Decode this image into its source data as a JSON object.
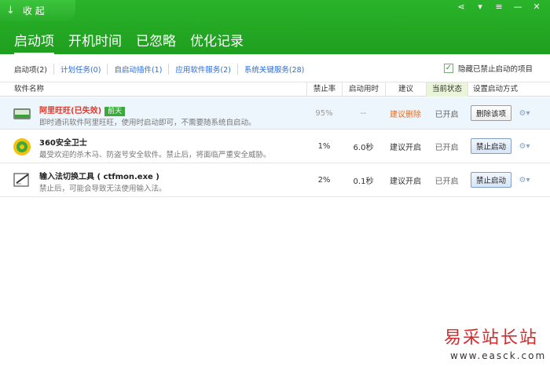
{
  "header": {
    "collapse_label": "收 起",
    "tabs": [
      {
        "label": "启动项"
      },
      {
        "label": "开机时间"
      },
      {
        "label": "已忽略"
      },
      {
        "label": "优化记录"
      }
    ]
  },
  "subnav": {
    "items": [
      {
        "label": "启动项(2)"
      },
      {
        "label": "计划任务(0)"
      },
      {
        "label": "自启动插件(1)"
      },
      {
        "label": "应用软件服务(2)"
      },
      {
        "label": "系统关键服务(28)"
      }
    ],
    "hide_disabled_label": "隐藏已禁止启动的项目",
    "hide_disabled_checked": true
  },
  "table": {
    "headers": {
      "name": "软件名称",
      "ban_rate": "禁止率",
      "boot_time": "启动用时",
      "suggestion": "建议",
      "state": "当前状态",
      "set": "设置启动方式"
    },
    "rows": [
      {
        "icon": "aliwangwang-icon",
        "name": "阿里旺旺(已失效)",
        "badge": "前天",
        "desc": "即时通讯软件阿里旺旺，使用时启动即可，不需要随系统自启动。",
        "ban_rate": "95%",
        "boot_time": "--",
        "suggestion": "建议删除",
        "state": "已开启",
        "button": "删除该项"
      },
      {
        "icon": "360-shield-icon",
        "name": "360安全卫士",
        "badge": "",
        "desc": "最受欢迎的杀木马、防盗号安全软件。禁止后，将面临严重安全威胁。",
        "ban_rate": "1%",
        "boot_time": "6.0秒",
        "suggestion": "建议开启",
        "state": "已开启",
        "button": "禁止启动"
      },
      {
        "icon": "input-method-icon",
        "name": "输入法切换工具 ( ctfmon.exe )",
        "badge": "",
        "desc": "禁止后，可能会导致无法使用输入法。",
        "ban_rate": "2%",
        "boot_time": "0.1秒",
        "suggestion": "建议开启",
        "state": "已开启",
        "button": "禁止启动"
      }
    ]
  },
  "watermark": {
    "title": "易采站长站",
    "url": "www.easck.com"
  },
  "colors": {
    "header_green": "#22a822",
    "link_blue": "#2b6bd6",
    "invalid_red": "#e0392b",
    "suggest_orange": "#e86a1a"
  }
}
